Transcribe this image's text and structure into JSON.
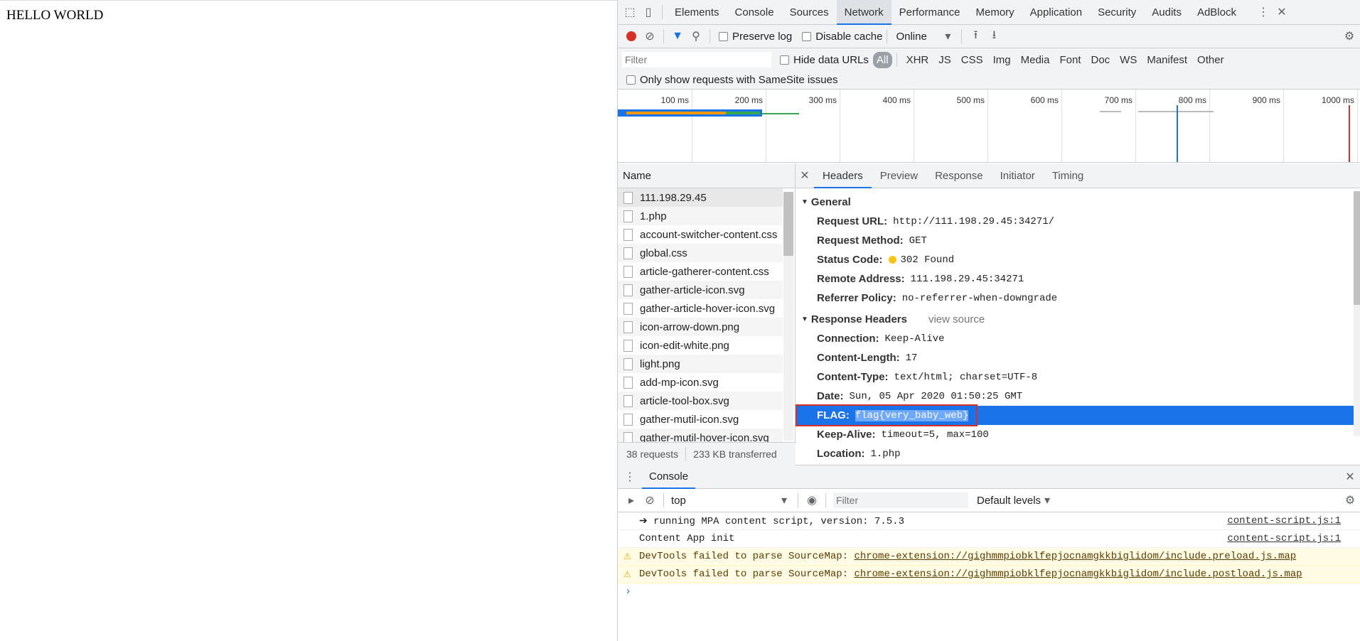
{
  "page": {
    "text": "HELLO WORLD"
  },
  "devtools": {
    "tabs": [
      "Elements",
      "Console",
      "Sources",
      "Network",
      "Performance",
      "Memory",
      "Application",
      "Security",
      "Audits",
      "AdBlock"
    ],
    "active_tab": "Network",
    "toolbar": {
      "preserve_log": "Preserve log",
      "disable_cache": "Disable cache",
      "throttle": "Online"
    },
    "filter": {
      "placeholder": "Filter",
      "hide_data_urls": "Hide data URLs",
      "types": [
        "All",
        "XHR",
        "JS",
        "CSS",
        "Img",
        "Media",
        "Font",
        "Doc",
        "WS",
        "Manifest",
        "Other"
      ],
      "samesite": "Only show requests with SameSite issues"
    },
    "timeline_ticks": [
      "100 ms",
      "200 ms",
      "300 ms",
      "400 ms",
      "500 ms",
      "600 ms",
      "700 ms",
      "800 ms",
      "900 ms",
      "1000 ms"
    ],
    "requests_header": "Name",
    "requests": [
      "111.198.29.45",
      "1.php",
      "account-switcher-content.css",
      "global.css",
      "article-gatherer-content.css",
      "gather-article-icon.svg",
      "gather-article-hover-icon.svg",
      "icon-arrow-down.png",
      "icon-edit-white.png",
      "light.png",
      "add-mp-icon.svg",
      "article-tool-box.svg",
      "gather-mutil-icon.svg",
      "gather-mutil-hover-icon.svg"
    ],
    "summary": {
      "requests": "38 requests",
      "transferred": "233 KB transferred"
    },
    "detail_tabs": [
      "Headers",
      "Preview",
      "Response",
      "Initiator",
      "Timing"
    ],
    "general": {
      "title": "General",
      "rows": [
        {
          "k": "Request URL:",
          "v": "http://111.198.29.45:34271/"
        },
        {
          "k": "Request Method:",
          "v": "GET"
        },
        {
          "k": "Status Code:",
          "v": "302 Found"
        },
        {
          "k": "Remote Address:",
          "v": "111.198.29.45:34271"
        },
        {
          "k": "Referrer Policy:",
          "v": "no-referrer-when-downgrade"
        }
      ]
    },
    "response_headers": {
      "title": "Response Headers",
      "view_source": "view source",
      "rows": [
        {
          "k": "Connection:",
          "v": "Keep-Alive"
        },
        {
          "k": "Content-Length:",
          "v": "17"
        },
        {
          "k": "Content-Type:",
          "v": "text/html; charset=UTF-8"
        },
        {
          "k": "Date:",
          "v": "Sun, 05 Apr 2020 01:50:25 GMT"
        },
        {
          "k": "FLAG:",
          "v": "flag{very_baby_web}"
        },
        {
          "k": "Keep-Alive:",
          "v": "timeout=5, max=100"
        },
        {
          "k": "Location:",
          "v": "1.php"
        }
      ]
    },
    "console": {
      "tab": "Console",
      "context": "top",
      "filter_placeholder": "Filter",
      "levels": "Default levels",
      "lines": [
        {
          "text": "➔ running MPA content script, version: 7.5.3",
          "src": "content-script.js:1",
          "warn": false
        },
        {
          "text": "Content App init",
          "src": "content-script.js:1",
          "warn": false
        },
        {
          "text": "DevTools failed to parse SourceMap: ",
          "link": "chrome-extension://gighmmpiobklfepjocnamgkkbiglidom/include.preload.js.map",
          "warn": true
        },
        {
          "text": "DevTools failed to parse SourceMap: ",
          "link": "chrome-extension://gighmmpiobklfepjocnamgkkbiglidom/include.postload.js.map",
          "warn": true
        }
      ]
    }
  }
}
